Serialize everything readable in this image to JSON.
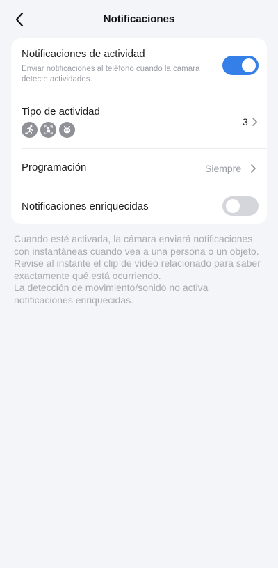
{
  "header": {
    "title": "Notificaciones"
  },
  "settings": {
    "activity_notifications": {
      "title": "Notificaciones de actividad",
      "subtitle": "Enviar notificaciones al teléfono cuando la cámara detecte actividades.",
      "enabled": true
    },
    "activity_type": {
      "title": "Tipo de actividad",
      "icons": [
        "motion-icon",
        "person-icon",
        "pet-icon"
      ],
      "count": "3"
    },
    "schedule": {
      "title": "Programación",
      "value": "Siempre"
    },
    "rich_notifications": {
      "title": "Notificaciones enriquecidas",
      "enabled": false
    }
  },
  "footnote": "Cuando esté activada, la cámara enviará notificaciones con instantáneas cuando vea a una persona o un objeto. Revise al instante el clip de vídeo relacionado para saber exactamente qué está ocurriendo.\nLa detección de movimiento/sonido no activa notificaciones enriquecidas.",
  "colors": {
    "accent": "#3480e8",
    "background": "#f4f5f9",
    "toggle_off": "#d4d6db",
    "icon_badge": "#8f9197"
  }
}
